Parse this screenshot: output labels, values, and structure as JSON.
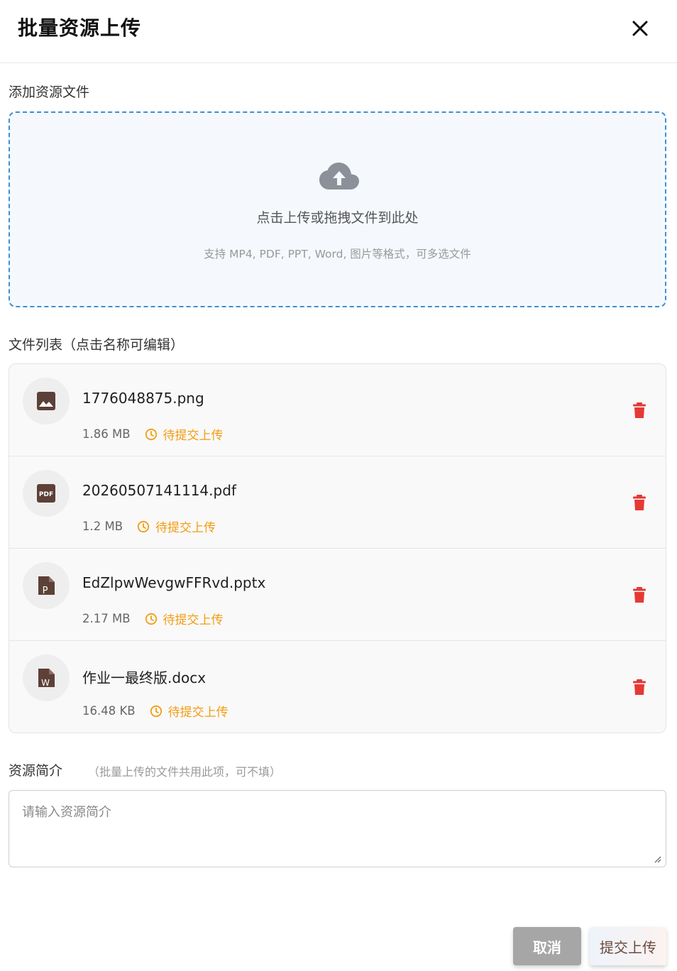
{
  "header": {
    "title": "批量资源上传",
    "close_icon": "close-icon"
  },
  "upload": {
    "section_label": "添加资源文件",
    "main_text": "点击上传或拖拽文件到此处",
    "sub_text": "支持 MP4, PDF, PPT, Word, 图片等格式，可多选文件",
    "icon": "cloud-upload-icon",
    "border_color": "#3f8fd0"
  },
  "file_list": {
    "section_label": "文件列表（点击名称可编辑）",
    "files": [
      {
        "name": "1776048875.png",
        "size": "1.86 MB",
        "status": "待提交上传",
        "icon": "image-file-icon"
      },
      {
        "name": "20260507141114.pdf",
        "size": "1.2 MB",
        "status": "待提交上传",
        "icon": "pdf-file-icon"
      },
      {
        "name": "EdZlpwWevgwFFRvd.pptx",
        "size": "2.17 MB",
        "status": "待提交上传",
        "icon": "ppt-file-icon"
      },
      {
        "name": "作业一最终版.docx",
        "size": "16.48 KB",
        "status": "待提交上传",
        "icon": "word-file-icon"
      }
    ],
    "status_color": "#f39c12",
    "delete_color": "#e53935"
  },
  "intro": {
    "label": "资源简介",
    "hint": "（批量上传的文件共用此项，可不填）",
    "placeholder": "请输入资源简介"
  },
  "footer": {
    "cancel_label": "取消",
    "submit_label": "提交上传"
  }
}
